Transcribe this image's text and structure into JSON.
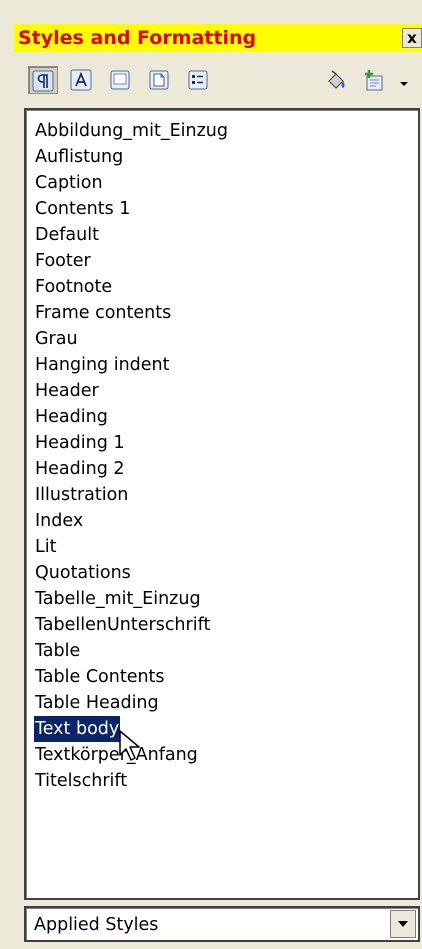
{
  "panel": {
    "title": "Styles and Formatting",
    "close_label": "x"
  },
  "toolbar": {
    "buttons": [
      {
        "icon": "paragraph-styles-icon",
        "active": true
      },
      {
        "icon": "character-styles-icon",
        "active": false
      },
      {
        "icon": "frame-styles-icon",
        "active": false
      },
      {
        "icon": "page-styles-icon",
        "active": false
      },
      {
        "icon": "list-styles-icon",
        "active": false
      },
      {
        "icon": "fill-format-mode-icon",
        "active": false
      },
      {
        "icon": "new-style-from-selection-icon",
        "active": false
      }
    ]
  },
  "styles_list": {
    "items": [
      "Abbildung_mit_Einzug",
      "Auflistung",
      "Caption",
      "Contents 1",
      "Default",
      "Footer",
      "Footnote",
      "Frame contents",
      "Grau",
      "Hanging indent",
      "Header",
      "Heading",
      "Heading 1",
      "Heading 2",
      "Illustration",
      "Index",
      "Lit",
      "Quotations",
      "Tabelle_mit_Einzug",
      "TabellenUnterschrift",
      "Table",
      "Table Contents",
      "Table Heading",
      "Text body",
      "Textkörper_Anfang",
      "Titelschrift"
    ],
    "selected": "Text body"
  },
  "filter": {
    "value": "Applied Styles"
  },
  "colors": {
    "title_background": "#ffff00",
    "title_text": "#e60000",
    "selection": "#0a246a"
  }
}
